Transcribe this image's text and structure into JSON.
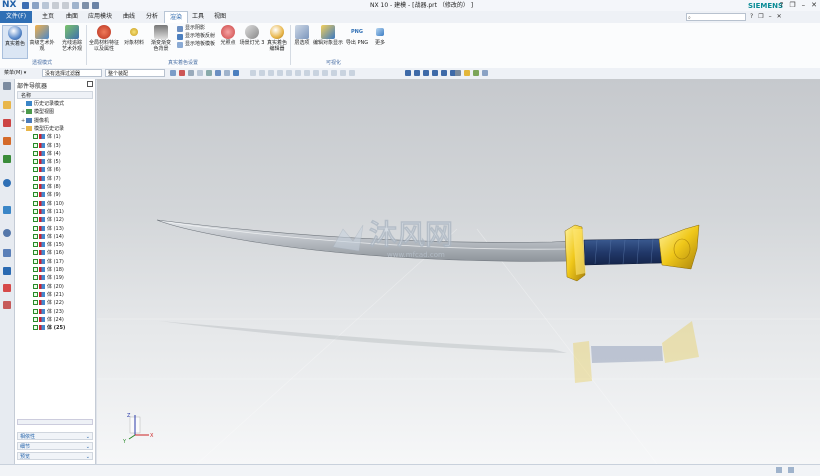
{
  "app": {
    "brand": "NX",
    "window_title": "NX 10 - 建模 - [战器.prt （修改的） ]",
    "vendor": "SIEMENS",
    "window_buttons": [
      "?",
      "❐",
      "–",
      "✕"
    ]
  },
  "menu": {
    "file_tab": "文件(F)",
    "tabs": [
      "主页",
      "曲面",
      "应用模块",
      "曲线",
      "分析",
      "渲染",
      "工具",
      "视图"
    ],
    "active_tab": "渲染",
    "right_icons": [
      "?",
      "❐",
      "–",
      "✕"
    ]
  },
  "ribbon": {
    "buttons": [
      {
        "label": "真实着色",
        "icon": "true-shading-icon"
      },
      {
        "label": "高级艺术外观",
        "icon": "advanced-studio-icon"
      },
      {
        "label": "光线追踪\n艺术外观",
        "icon": "ray-traced-studio-icon"
      },
      {
        "label": "全局材料特征\n以及属性",
        "icon": "global-material-icon"
      },
      {
        "label": "对象材料",
        "icon": "object-material-icon"
      },
      {
        "label": "渐变渐变\n色背景",
        "icon": "gradient-background-icon"
      },
      {
        "label": "光照点",
        "icon": "light-point-icon"
      },
      {
        "label": "场景灯光 3",
        "icon": "scene-light-icon"
      },
      {
        "label": "真实着色\n编辑器",
        "icon": "true-shading-editor-icon"
      },
      {
        "label": "层选项",
        "icon": "layer-option-icon"
      },
      {
        "label": "编辑对象显示",
        "icon": "edit-object-display-icon"
      },
      {
        "label": "导出 PNG",
        "icon": "export-png-icon"
      },
      {
        "label": "更多",
        "icon": "more-icon"
      }
    ],
    "checklist": [
      {
        "label": "显示阴影",
        "checked": true
      },
      {
        "label": "显示地板反射",
        "checked": true
      },
      {
        "label": "显示地板模板",
        "checked": true
      }
    ],
    "png_badge": "PNG",
    "groups": [
      "透视模式",
      "真实着色设置",
      "可视化"
    ]
  },
  "toolbar": {
    "menu_button": "菜单(M) ▾",
    "selection_filter": "没有选择过滤器",
    "assembly_scope": "整个装配",
    "icon_groups": [
      "select-icons",
      "snap-icons",
      "view-icons",
      "render-style-icons"
    ]
  },
  "resource_bar": {
    "icons": [
      "part-navigator-icon",
      "assembly-navigator-icon",
      "constraint-navigator-icon",
      "reuse-library-icon",
      "hd3d-tools-icon",
      "web-browser-icon",
      "history-icon",
      "process-studio-icon",
      "roles-icon",
      "system-materials-icon",
      "system-scene-icon"
    ]
  },
  "navigator": {
    "title": "部件导航器",
    "column_header": "名称",
    "items": [
      {
        "label": "历史记录模式",
        "level": 0,
        "icon": "history-icon"
      },
      {
        "label": "模型视图",
        "level": 0,
        "icon": "model-view-icon"
      },
      {
        "label": "摄像机",
        "level": 0,
        "icon": "camera-icon"
      },
      {
        "label": "模型历史记录",
        "level": 0,
        "icon": "model-history-icon"
      },
      {
        "label": "体 (1)",
        "level": 1
      },
      {
        "label": "体 (3)",
        "level": 1
      },
      {
        "label": "体 (4)",
        "level": 1
      },
      {
        "label": "体 (5)",
        "level": 1
      },
      {
        "label": "体 (6)",
        "level": 1
      },
      {
        "label": "体 (7)",
        "level": 1
      },
      {
        "label": "体 (8)",
        "level": 1
      },
      {
        "label": "体 (9)",
        "level": 1
      },
      {
        "label": "体 (10)",
        "level": 1
      },
      {
        "label": "体 (11)",
        "level": 1
      },
      {
        "label": "体 (12)",
        "level": 1
      },
      {
        "label": "体 (13)",
        "level": 1
      },
      {
        "label": "体 (14)",
        "level": 1
      },
      {
        "label": "体 (15)",
        "level": 1
      },
      {
        "label": "体 (16)",
        "level": 1
      },
      {
        "label": "体 (17)",
        "level": 1
      },
      {
        "label": "体 (18)",
        "level": 1
      },
      {
        "label": "体 (19)",
        "level": 1
      },
      {
        "label": "体 (20)",
        "level": 1
      },
      {
        "label": "体 (21)",
        "level": 1
      },
      {
        "label": "体 (22)",
        "level": 1
      },
      {
        "label": "体 (23)",
        "level": 1
      },
      {
        "label": "体 (24)",
        "level": 1
      },
      {
        "label": "体 (25)",
        "level": 1,
        "bold": true
      }
    ],
    "panels": [
      "相依性",
      "细节",
      "预览"
    ]
  },
  "viewport": {
    "watermark": "沐风网",
    "watermark_url": "www.mfcad.com",
    "triad_axes": [
      "X",
      "Y",
      "Z"
    ]
  },
  "colors": {
    "accent": "#2f6fb5",
    "blade": "#c8ccd0",
    "guard_gold": "#e8c21a",
    "grip_blue": "#26406e",
    "background_top": "#c6c9cd",
    "background_bottom": "#f6f7f8"
  }
}
